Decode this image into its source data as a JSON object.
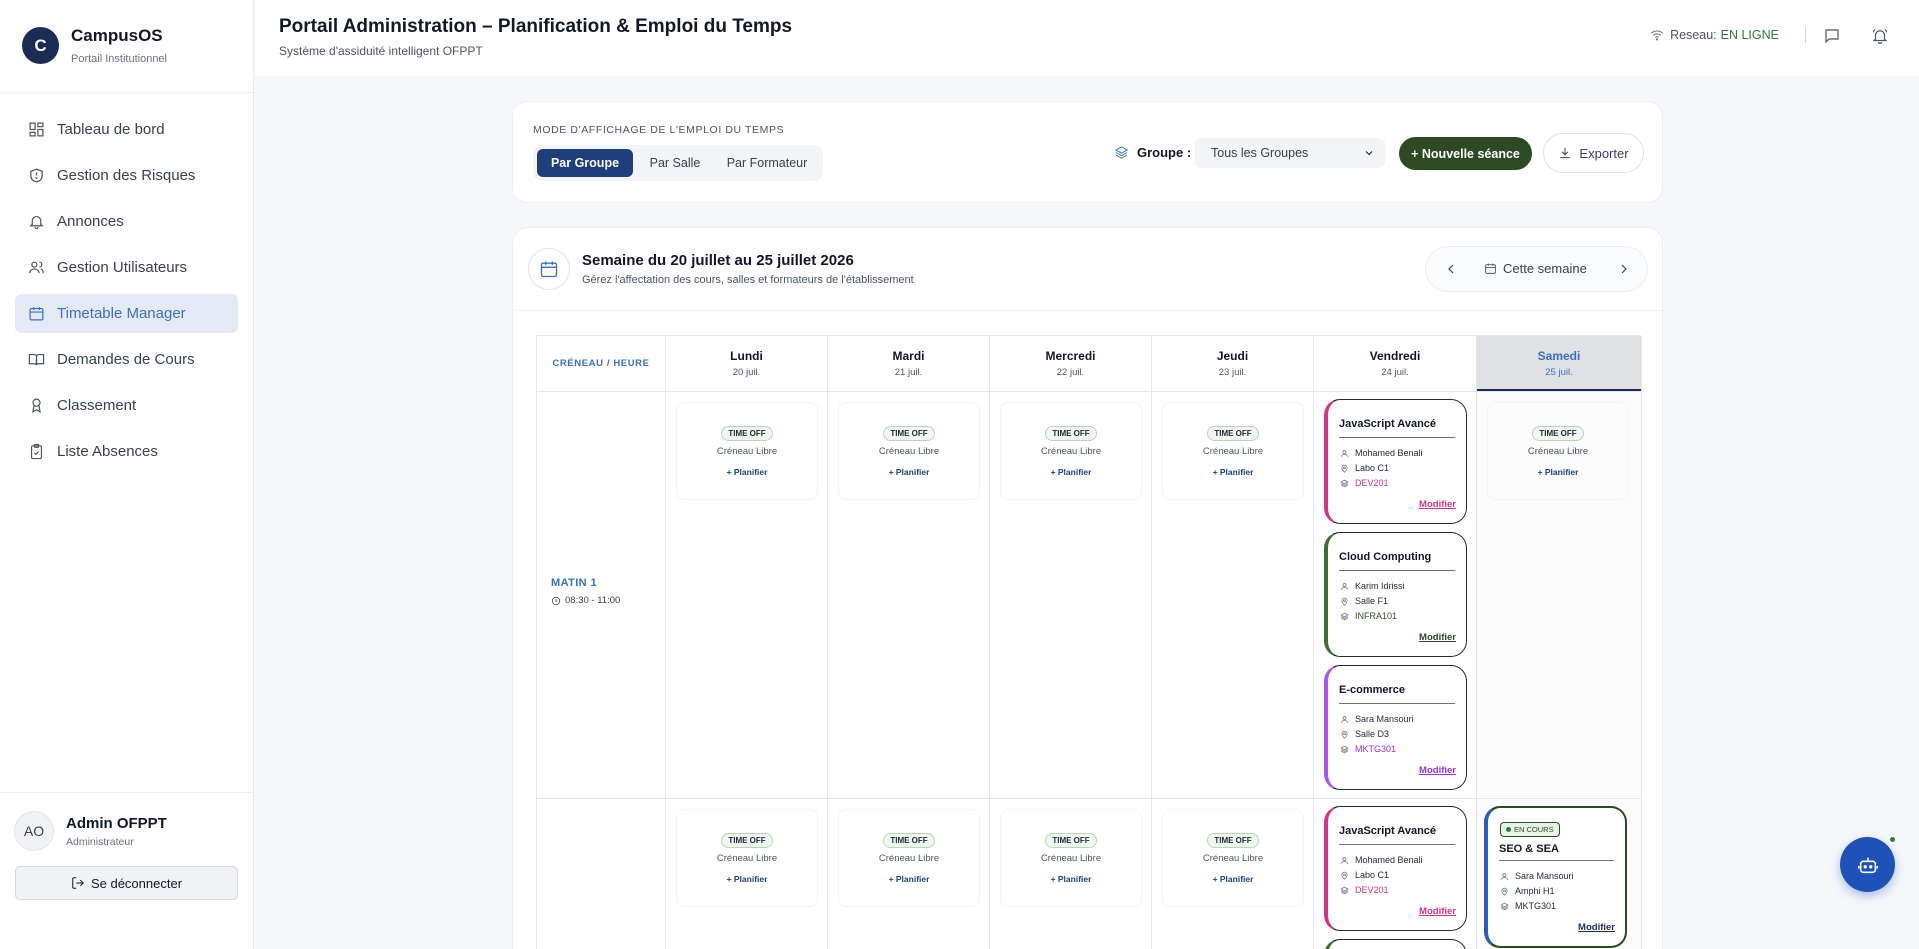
{
  "brand": {
    "initial": "C",
    "name": "CampusOS",
    "subtitle": "Portail Institutionnel"
  },
  "sidebar": {
    "items": [
      {
        "label": "Tableau de bord",
        "icon": "dashboard-icon"
      },
      {
        "label": "Gestion des Risques",
        "icon": "shield-icon"
      },
      {
        "label": "Annonces",
        "icon": "bell-icon"
      },
      {
        "label": "Gestion Utilisateurs",
        "icon": "users-icon"
      },
      {
        "label": "Timetable Manager",
        "icon": "calendar-icon",
        "active": true
      },
      {
        "label": "Demandes de Cours",
        "icon": "book-icon"
      },
      {
        "label": "Classement",
        "icon": "award-icon"
      },
      {
        "label": "Liste Absences",
        "icon": "clipboard-check-icon"
      }
    ]
  },
  "user": {
    "initials": "AO",
    "name": "Admin OFPPT",
    "role": "Administrateur",
    "logout_label": "Se déconnecter"
  },
  "header": {
    "title": "Portail Administration – Planification & Emploi du Temps",
    "subtitle": "Système d'assiduité intelligent OFPPT",
    "network_label": "Reseau:",
    "network_status": "EN LIGNE"
  },
  "mode": {
    "label": "MODE D'AFFICHAGE DE L'EMPLOI DU TEMPS",
    "tabs": [
      "Par Groupe",
      "Par Salle",
      "Par Formateur"
    ],
    "active_tab": "Par Groupe",
    "group_label": "Groupe :",
    "group_value": "Tous les Groupes",
    "new_session_label": "+ Nouvelle séance",
    "export_label": "Exporter"
  },
  "week": {
    "title": "Semaine du 20 juillet au 25 juillet 2026",
    "subtitle": "Gérez l'affectation des cours, salles et formateurs de l'établissement",
    "today_label": "Cette semaine"
  },
  "grid": {
    "slot_header": "CRÉNEAU / HEURE",
    "days": [
      {
        "name": "Lundi",
        "date": "20 juil."
      },
      {
        "name": "Mardi",
        "date": "21 juil."
      },
      {
        "name": "Mercredi",
        "date": "22 juil."
      },
      {
        "name": "Jeudi",
        "date": "23 juil."
      },
      {
        "name": "Vendredi",
        "date": "24 juil."
      },
      {
        "name": "Samedi",
        "date": "25 juil.",
        "current": true
      }
    ],
    "slots": [
      {
        "name": "MATIN 1",
        "time": "08:30 - 11:00"
      }
    ],
    "free_cell": {
      "badge": "TIME OFF",
      "label": "Créneau Libre",
      "action": "+ Planifier"
    },
    "sessions": [
      {
        "title": "JavaScript Avancé",
        "trainer": "Mohamed Benali",
        "room": "Labo C1",
        "group": "DEV201",
        "accent": "#d63384",
        "edit": "Modifier"
      },
      {
        "title": "Cloud Computing",
        "trainer": "Karim Idrissi",
        "room": "Salle F1",
        "group": "INFRA101",
        "accent": "#3f6e2e",
        "edit": "Modifier"
      },
      {
        "title": "E-commerce",
        "trainer": "Sara Mansouri",
        "room": "Salle D3",
        "group": "MKTG301",
        "accent": "#a855f7",
        "edit": "Modifier"
      },
      {
        "title": "JavaScript Avancé",
        "trainer": "Mohamed Benali",
        "room": "Labo C1",
        "group": "DEV201",
        "accent": "#d63384",
        "edit": "Modifier"
      },
      {
        "title": "SEO & SEA",
        "trainer": "Sara Mansouri",
        "room": "Amphi H1",
        "group": "MKTG301",
        "accent": "#2d5bc2",
        "edit": "Modifier",
        "live_badge": "EN COURS"
      }
    ]
  },
  "colors": {
    "primary": "#1c2d55",
    "accent_blue": "#3a6fc5",
    "success": "#2c4b22",
    "online": "#2f7a3a"
  }
}
